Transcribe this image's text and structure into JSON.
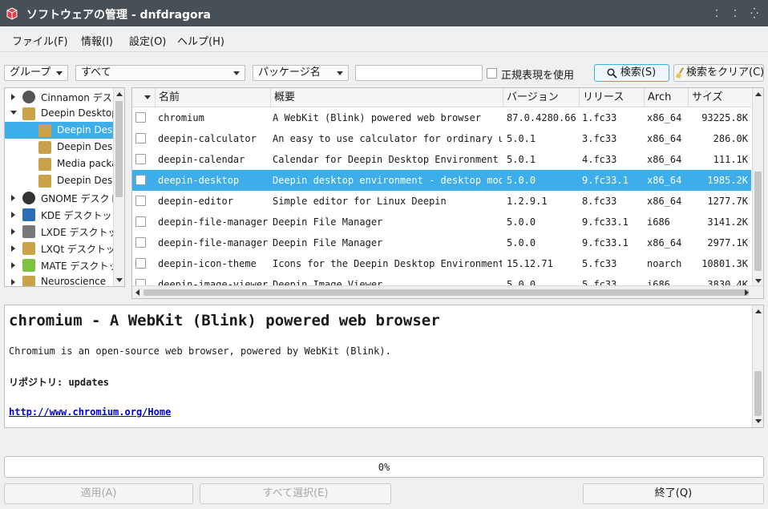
{
  "window": {
    "title": "ソフトウェアの管理 - dnfdragora",
    "app_icon": "package-icon",
    "controls": {
      "help": "⁚",
      "minimize": "⁚",
      "close": "⁛"
    }
  },
  "menu": [
    {
      "label": "ファイル(F)"
    },
    {
      "label": "情報(I)"
    },
    {
      "label": "設定(O)"
    },
    {
      "label": "ヘルプ(H)"
    }
  ],
  "toolbar": {
    "group_combo": "グループ",
    "filter_combo": "すべて",
    "field_combo": "パッケージ名",
    "search_value": "",
    "regex_label": "正規表現を使用",
    "search_button": "検索(S)",
    "clear_button": "検索をクリア(C)"
  },
  "tree": [
    {
      "label": "Cinnamon デスクトップ",
      "expanded": false,
      "depth": 0,
      "icon": "cinnamon-icon",
      "color": "#555555"
    },
    {
      "label": "Deepin Desktop",
      "expanded": true,
      "depth": 0,
      "icon": "folder-icon",
      "color": "#c9a24a"
    },
    {
      "label": "Deepin Desktop",
      "depth": 1,
      "icon": "folder-icon",
      "color": "#c9a24a",
      "selected": true
    },
    {
      "label": "Deepin Desktop",
      "depth": 1,
      "icon": "folder-icon",
      "color": "#c9a24a"
    },
    {
      "label": "Media packages",
      "depth": 1,
      "icon": "folder-icon",
      "color": "#c9a24a"
    },
    {
      "label": "Deepin Desktop",
      "depth": 1,
      "icon": "folder-icon",
      "color": "#c9a24a"
    },
    {
      "label": "GNOME デスクトップ",
      "expanded": false,
      "depth": 0,
      "icon": "gnome-icon",
      "color": "#333333"
    },
    {
      "label": "KDE デスクトップ",
      "expanded": false,
      "depth": 0,
      "icon": "kde-icon",
      "color": "#2a6fb5"
    },
    {
      "label": "LXDE デスクトップ",
      "expanded": false,
      "depth": 0,
      "icon": "lxde-icon",
      "color": "#777777"
    },
    {
      "label": "LXQt デスクトップ",
      "expanded": false,
      "depth": 0,
      "icon": "folder-icon",
      "color": "#c9a24a"
    },
    {
      "label": "MATE デスクトップ",
      "expanded": false,
      "depth": 0,
      "icon": "mate-icon",
      "color": "#7fc241"
    },
    {
      "label": "Neuroscience",
      "expanded": false,
      "depth": 0,
      "icon": "folder-icon",
      "color": "#c9a24a"
    }
  ],
  "columns": [
    "名前",
    "概要",
    "バージョン",
    "リリース",
    "Arch",
    "サイズ"
  ],
  "packages": [
    {
      "name": "chromium",
      "summary": "A WebKit (Blink) powered web browser",
      "version": "87.0.4280.66",
      "release": "1.fc33",
      "arch": "x86_64",
      "size": "93225.8K"
    },
    {
      "name": "deepin-calculator",
      "summary": "An easy to use calculator for ordinary users",
      "version": "5.0.1",
      "release": "3.fc33",
      "arch": "x86_64",
      "size": "286.0K"
    },
    {
      "name": "deepin-calendar",
      "summary": "Calendar for Deepin Desktop Environment",
      "version": "5.0.1",
      "release": "4.fc33",
      "arch": "x86_64",
      "size": "111.1K"
    },
    {
      "name": "deepin-desktop",
      "summary": "Deepin desktop environment - desktop module",
      "version": "5.0.0",
      "release": "9.fc33.1",
      "arch": "x86_64",
      "size": "1985.2K",
      "selected": true
    },
    {
      "name": "deepin-editor",
      "summary": "Simple editor for Linux Deepin",
      "version": "1.2.9.1",
      "release": "8.fc33",
      "arch": "x86_64",
      "size": "1277.7K"
    },
    {
      "name": "deepin-file-manager",
      "summary": "Deepin File Manager",
      "version": "5.0.0",
      "release": "9.fc33.1",
      "arch": "i686",
      "size": "3141.2K"
    },
    {
      "name": "deepin-file-manager",
      "summary": "Deepin File Manager",
      "version": "5.0.0",
      "release": "9.fc33.1",
      "arch": "x86_64",
      "size": "2977.1K"
    },
    {
      "name": "deepin-icon-theme",
      "summary": "Icons for the Deepin Desktop Environment",
      "version": "15.12.71",
      "release": "5.fc33",
      "arch": "noarch",
      "size": "10801.3K"
    },
    {
      "name": "deepin-image-viewer",
      "summary": "Deepin Image Viewer",
      "version": "5.0.0",
      "release": "5.fc33",
      "arch": "i686",
      "size": "3830.4K"
    }
  ],
  "details": {
    "title": "chromium - A WebKit (Blink) powered web browser",
    "description": "Chromium is an open-source web browser, powered by WebKit (Blink).",
    "repo": "リポジトリ: updates",
    "url": "http://www.chromium.org/Home"
  },
  "progress": {
    "value": 0,
    "label": "0%"
  },
  "buttons": {
    "apply": "適用(A)",
    "select_all": "すべて選択(E)",
    "quit": "終了(Q)"
  },
  "colors": {
    "titlebar": "#475057",
    "selection": "#3daee9",
    "link": "#0000cc"
  }
}
